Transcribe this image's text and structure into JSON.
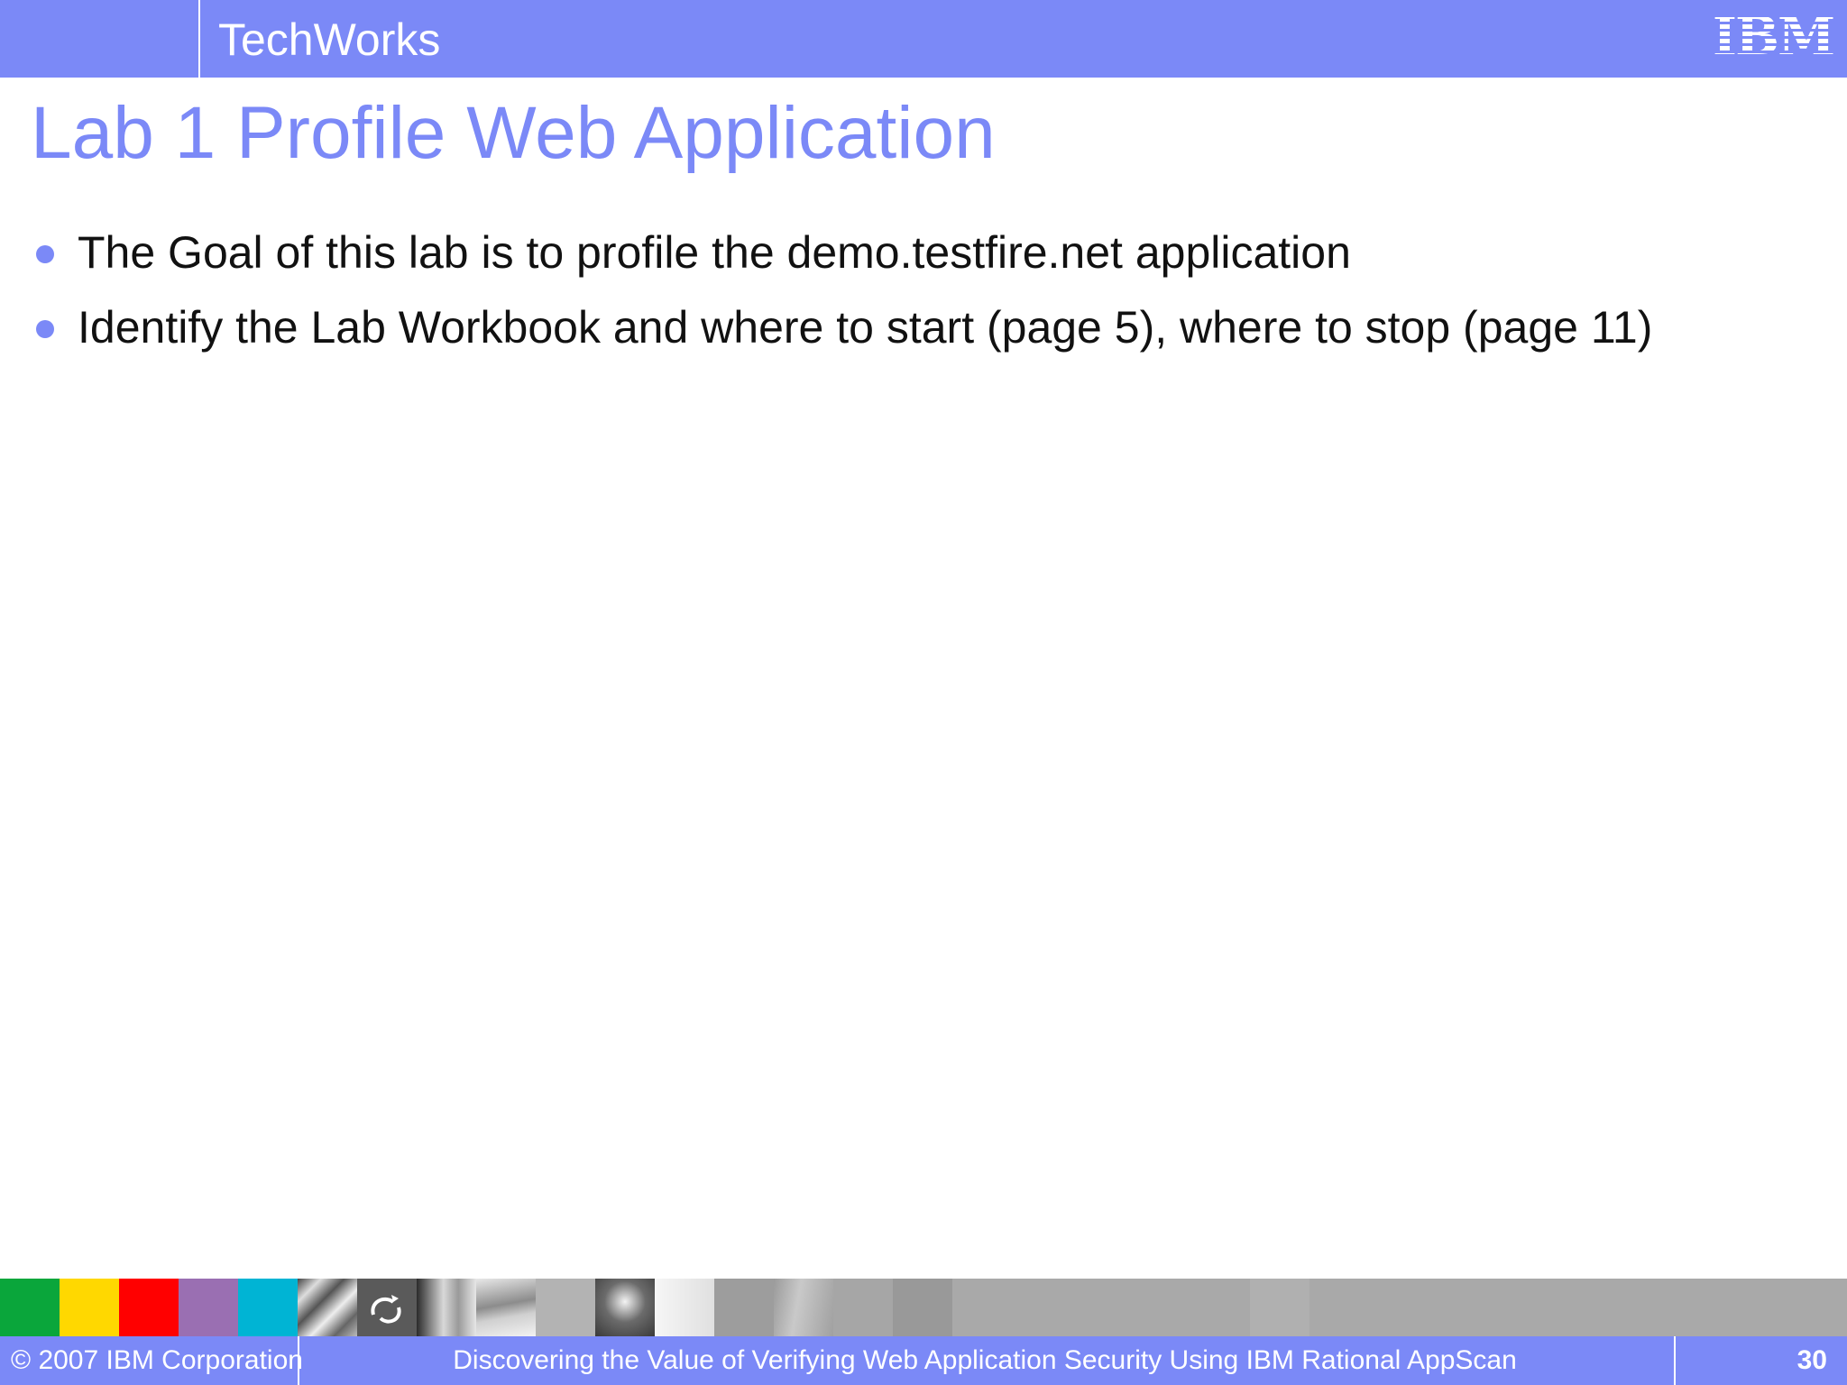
{
  "header": {
    "brand": "TechWorks",
    "logo_text": "IBM",
    "colors": {
      "bar": "#7b89f7",
      "text": "#ffffff"
    }
  },
  "slide": {
    "title": "Lab 1 Profile Web Application",
    "bullets": [
      "The Goal of this lab is to profile the demo.testfire.net application",
      "Identify the Lab Workbook and where to start (page 5), where to stop (page 11)"
    ],
    "colors": {
      "title": "#7b89f7",
      "bullet": "#7b89f7",
      "text": "#111111"
    }
  },
  "strip": {
    "swatch_colors": [
      "#0aa63b",
      "#ffd800",
      "#ff0000",
      "#9a6fb2",
      "#00b4d4"
    ]
  },
  "footer": {
    "copyright": "© 2007 IBM Corporation",
    "title": "Discovering the Value of Verifying Web Application Security Using IBM Rational AppScan",
    "page_number": "30"
  }
}
